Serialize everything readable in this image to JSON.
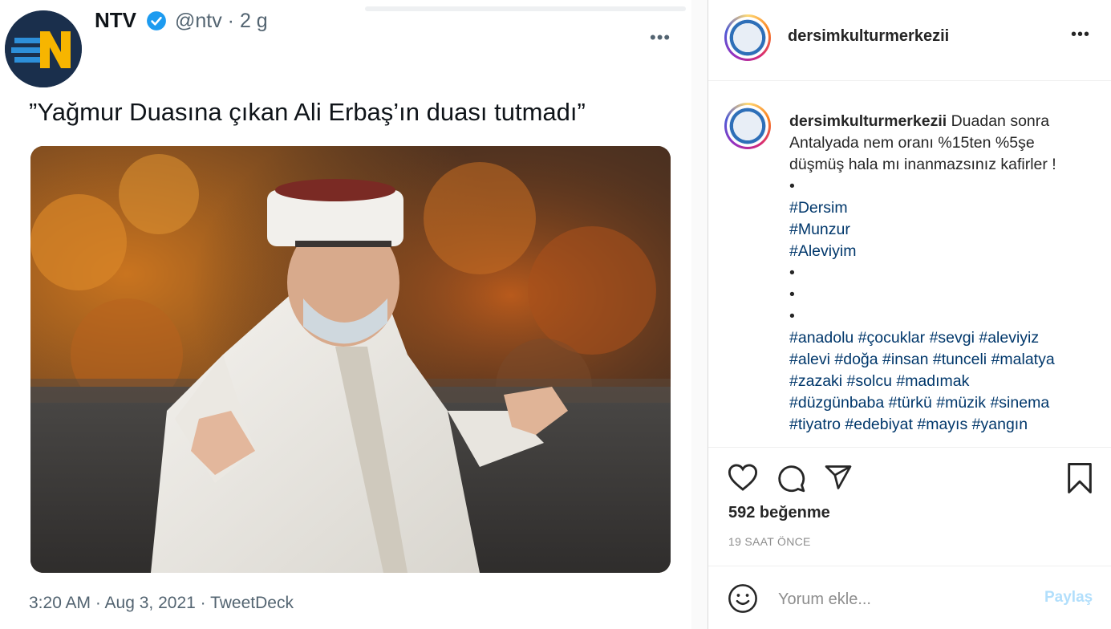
{
  "tweet": {
    "name": "NTV",
    "handle": "@ntv · 2 g",
    "text": "”Yağmur Duasına çıkan Ali Erbaş’ın duası tutmadı”",
    "meta": "3:20 AM · Aug 3, 2021 · TweetDeck",
    "more_label": "•••",
    "avatar_icon": "ntv-logo-icon",
    "verified_icon": "verified-badge-icon",
    "colors": {
      "verified": "#1d9bf0",
      "logo_bg": "#1a2f4c",
      "logo_accent": "#f7b500"
    }
  },
  "instagram": {
    "header": {
      "username": "dersimkulturmerkezii",
      "more_label": "•••"
    },
    "caption": {
      "username": "dersimkulturmerkezii",
      "text_line1": "Duadan sonra",
      "text_line2": "Antalyada nem oranı %15ten %5şe",
      "text_line3": "düşmüş hala mı inanmazsınız kafirler !",
      "bullet1": "•",
      "tag_dersim": "#Dersim",
      "tag_munzur": "#Munzur",
      "tag_aleviyim": "#Aleviyim",
      "bullet2": "•",
      "bullet3": "•",
      "bullet4": "•",
      "tags_row1": [
        "#anadolu",
        "#çocuklar",
        "#sevgi",
        "#aleviyiz"
      ],
      "tags_row2": [
        "#alevi",
        "#doğa",
        "#insan",
        "#tunceli",
        "#malatya"
      ],
      "tags_row3": [
        "#zazaki",
        "#solcu",
        "#madımak"
      ],
      "tags_row4": [
        "#düzgünbaba",
        "#türkü",
        "#müzik",
        "#sinema"
      ],
      "tags_row5": [
        "#tiyatro",
        "#edebiyat",
        "#mayıs",
        "#yangın"
      ]
    },
    "actions": {
      "like": "heart-icon",
      "comment": "comment-icon",
      "share": "send-icon",
      "save": "bookmark-icon"
    },
    "likes": "592 beğenme",
    "time": "19 SAAT ÖNCE",
    "comment": {
      "placeholder": "Yorum ekle...",
      "share_label": "Paylaş",
      "emoji_icon": "emoji-icon"
    },
    "colors": {
      "hashtag": "#00376b",
      "share_disabled": "#b2dffc",
      "text": "#262626",
      "muted": "#8e8e8e"
    }
  }
}
